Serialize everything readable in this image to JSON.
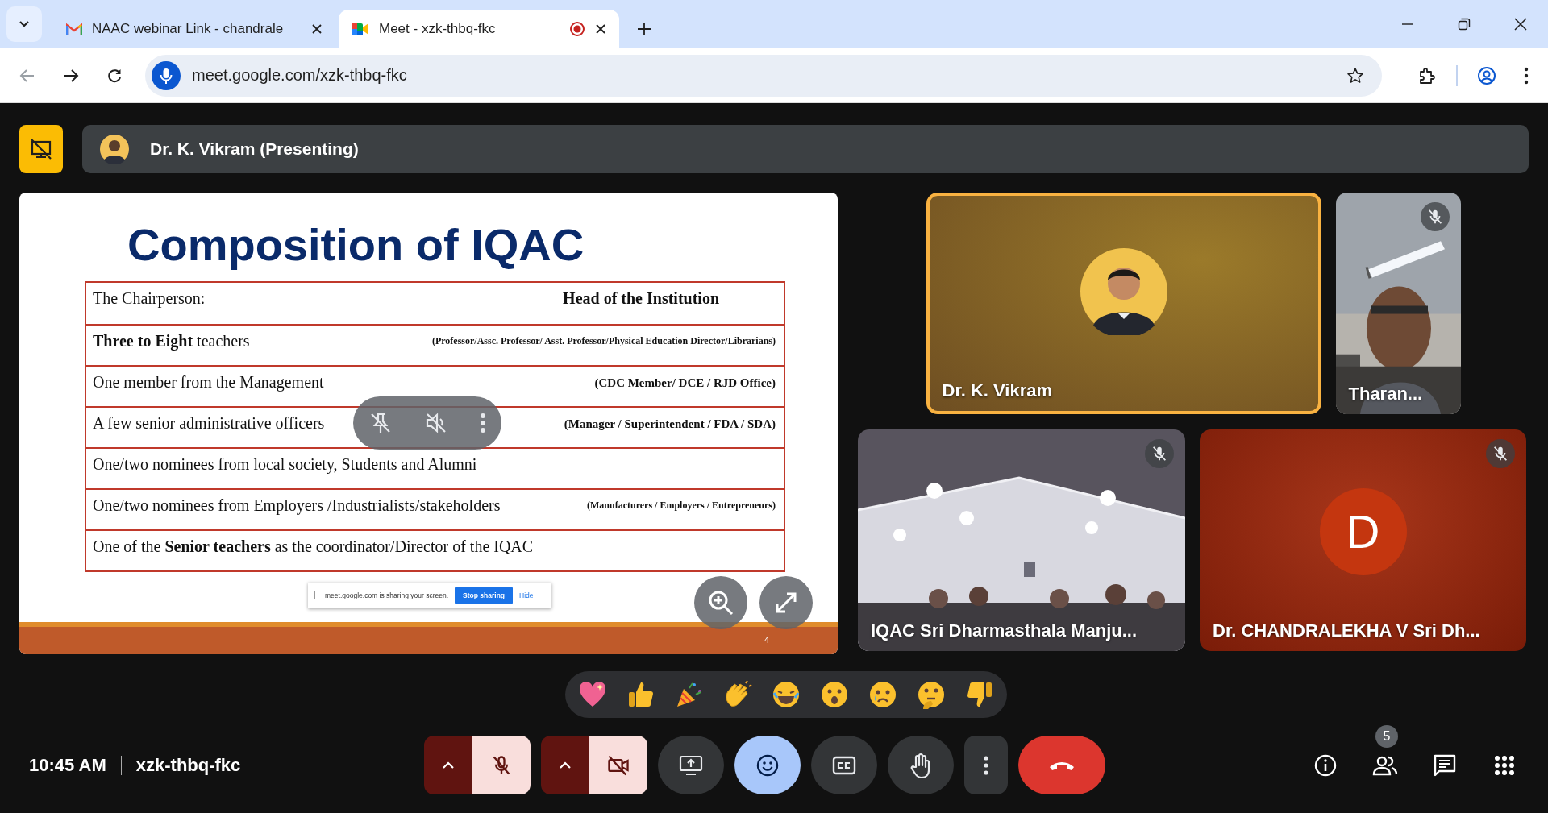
{
  "browser": {
    "tabs": [
      {
        "title": "NAAC webinar Link - chandrale",
        "kind": "mail",
        "selected": false,
        "recording": false
      },
      {
        "title": "Meet - xzk-thbq-fkc",
        "kind": "meet",
        "selected": true,
        "recording": true
      }
    ],
    "address": "meet.google.com/xzk-thbq-fkc"
  },
  "presenter": {
    "label": "Dr. K. Vikram (Presenting)"
  },
  "slide": {
    "title": "Composition of IQAC",
    "rows": [
      {
        "left": "The Chairperson:",
        "right": "Head of the Institution"
      },
      {
        "left": "**Three to Eight** teachers",
        "right": "(Professor/Assc. Professor/ Asst. Professor/Physical Education Director/Librarians)"
      },
      {
        "left": "One member from the Management",
        "right": "(CDC Member/ DCE / RJD Office)"
      },
      {
        "left": "A few senior administrative officers",
        "right": "(Manager / Superintendent / FDA / SDA)"
      },
      {
        "left": "One/two nominees from local society, Students and Alumni"
      },
      {
        "left": "One/two nominees from Employers /Industrialists/stakeholders",
        "right": "(Manufacturers / Employers / Entrepreneurs)"
      },
      {
        "left": "One of the **Senior teachers** as the coordinator/Director of the IQAC"
      }
    ],
    "page": "4"
  },
  "share_notice": {
    "text": "meet.google.com is sharing your screen.",
    "stop": "Stop sharing",
    "hide": "Hide"
  },
  "tiles": [
    {
      "name": "Dr. K. Vikram",
      "kind": "photo-avatar",
      "muted": false,
      "highlighted": true
    },
    {
      "name": "Tharan...",
      "kind": "video",
      "muted": true,
      "highlighted": false
    },
    {
      "name": "IQAC Sri Dharmasthala Manju...",
      "kind": "video",
      "muted": true,
      "highlighted": false
    },
    {
      "name": "Dr. CHANDRALEKHA V Sri Dh...",
      "kind": "letter-avatar",
      "initial": "D",
      "muted": true,
      "highlighted": false
    }
  ],
  "reactions": [
    {
      "kind": "heart"
    },
    {
      "kind": "thumbs-up"
    },
    {
      "kind": "party"
    },
    {
      "kind": "clap"
    },
    {
      "kind": "laugh"
    },
    {
      "kind": "surprised"
    },
    {
      "kind": "sad"
    },
    {
      "kind": "thinking"
    },
    {
      "kind": "thumbs-down"
    }
  ],
  "meeting": {
    "time": "10:45 AM",
    "code": "xzk-thbq-fkc"
  },
  "controls": [
    {
      "kind": "mic",
      "on": false
    },
    {
      "kind": "camera",
      "on": false
    },
    {
      "kind": "present",
      "on": false
    },
    {
      "kind": "reactions",
      "on": true
    },
    {
      "kind": "captions",
      "on": false
    },
    {
      "kind": "hand",
      "on": false
    },
    {
      "kind": "more"
    },
    {
      "kind": "leave"
    }
  ],
  "side_buttons": [
    {
      "kind": "info"
    },
    {
      "kind": "people",
      "badge": "5"
    },
    {
      "kind": "chat"
    },
    {
      "kind": "activities"
    }
  ]
}
